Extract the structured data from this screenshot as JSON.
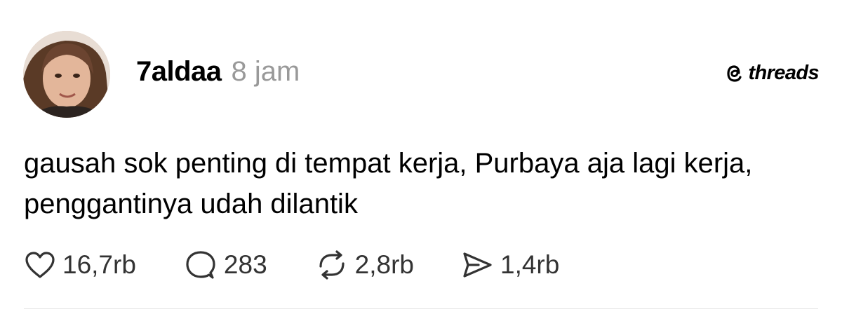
{
  "post": {
    "author": {
      "username": "7aldaa",
      "time": "8 jam",
      "avatar_icon": "profile-photo"
    },
    "brand": {
      "icon": "threads-logo-icon",
      "label": "threads"
    },
    "text": "gausah sok penting di tempat kerja, Purbaya aja lagi kerja, penggantinya udah dilantik",
    "actions": {
      "like": {
        "icon": "heart-icon",
        "count": "16,7rb"
      },
      "reply": {
        "icon": "comment-icon",
        "count": "283"
      },
      "repost": {
        "icon": "repost-icon",
        "count": "2,8rb"
      },
      "share": {
        "icon": "send-icon",
        "count": "1,4rb"
      }
    }
  },
  "colors": {
    "text": "#000000",
    "muted": "#999999",
    "icon": "#333333",
    "divider": "#e6e6e6",
    "background": "#ffffff"
  }
}
